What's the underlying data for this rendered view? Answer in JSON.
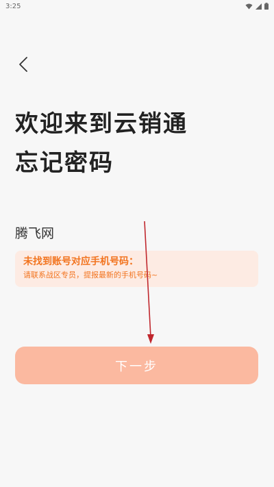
{
  "status_bar": {
    "time": "3:25"
  },
  "header": {
    "back_icon": "chevron-left-icon"
  },
  "title": {
    "line1": "欢迎来到云销通",
    "line2": "忘记密码"
  },
  "account": {
    "name": "腾飞网"
  },
  "notice": {
    "title": "未找到账号对应手机号码：",
    "description": "请联系战区专员，提报最新的手机号码~"
  },
  "actions": {
    "next_label": "下一步"
  },
  "colors": {
    "accent": "#f2741f",
    "button_bg": "#fbb9a0",
    "notice_bg": "#fdebe3",
    "annotation_arrow": "#c0272d"
  }
}
